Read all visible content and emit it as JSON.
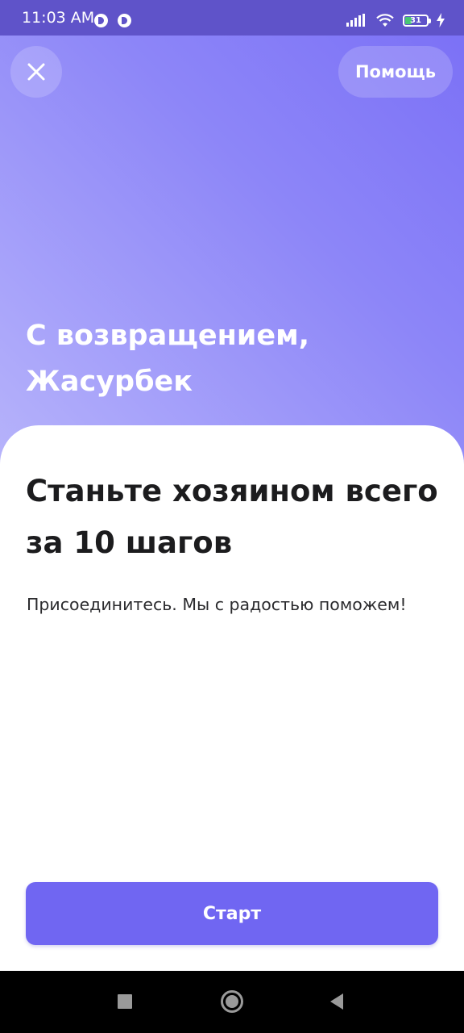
{
  "status_bar": {
    "time": "11:03 AM",
    "battery_level": "31",
    "icons": [
      "app-notification-icon",
      "app-notification-icon",
      "signal-icon",
      "wifi-icon",
      "battery-icon",
      "charging-icon"
    ]
  },
  "header": {
    "close_icon": "close-icon",
    "help_label": "Помощь"
  },
  "welcome": {
    "line1": "С возвращением,",
    "line2": "Жасурбек"
  },
  "sheet": {
    "title_line1": "Станьте хозяином всего",
    "title_line2": "за 10 шагов",
    "subtitle": "Присоединитесь. Мы с радостью поможем!",
    "start_label": "Старт"
  },
  "nav_bar": {
    "icons": [
      "recents-icon",
      "home-icon",
      "back-icon"
    ]
  },
  "colors": {
    "accent": "#7066f2",
    "status_bar": "#5f53c9",
    "gradient_start": "#7a6ff6",
    "gradient_end": "#b9b6fb"
  }
}
